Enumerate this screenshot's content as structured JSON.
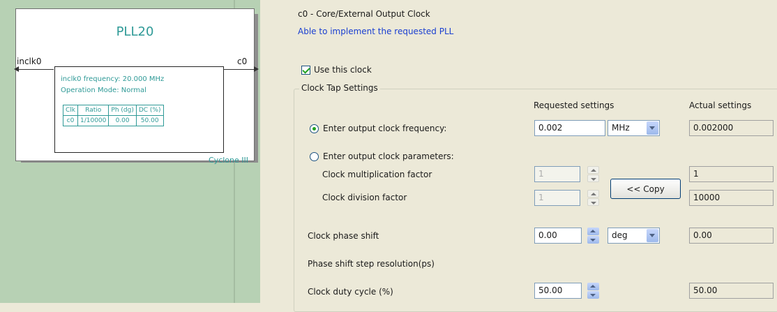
{
  "diagram": {
    "title": "PLL20",
    "input_pin": "inclk0",
    "output_pin": "c0",
    "frequency_line": "inclk0 frequency: 20.000 MHz",
    "mode_line": "Operation Mode: Normal",
    "table_headers": [
      "Clk",
      "Ratio",
      "Ph (dg)",
      "DC (%)"
    ],
    "table_row": [
      "c0",
      "1/10000",
      "0.00",
      "50.00"
    ],
    "device_family": "Cyclone III"
  },
  "header": {
    "clock_title": "c0 - Core/External Output Clock",
    "status": "Able to implement the requested PLL"
  },
  "use_clock": {
    "label": "Use this clock",
    "checked": true
  },
  "clock_tap": {
    "group_title": "Clock Tap Settings",
    "requested_header": "Requested settings",
    "actual_header": "Actual settings",
    "freq_radio_label": "Enter output clock frequency:",
    "freq_value": "0.002",
    "freq_unit": "MHz",
    "freq_actual": "0.002000",
    "params_radio_label": "Enter output clock parameters:",
    "mult_label": "Clock multiplication factor",
    "mult_value": "1",
    "mult_actual": "1",
    "div_label": "Clock division factor",
    "div_value": "1",
    "div_actual": "10000",
    "copy_button": "<< Copy",
    "phase_label": "Clock phase shift",
    "phase_value": "0.00",
    "phase_unit": "deg",
    "phase_actual": "0.00",
    "phase_res_label": "Phase shift step resolution(ps)",
    "duty_label": "Clock duty cycle (%)",
    "duty_value": "50.00",
    "duty_actual": "50.00"
  },
  "colors": {
    "pane_green": "#b7d1b4",
    "diagram_teal": "#2f9a97",
    "status_blue": "#1a3fd1"
  }
}
